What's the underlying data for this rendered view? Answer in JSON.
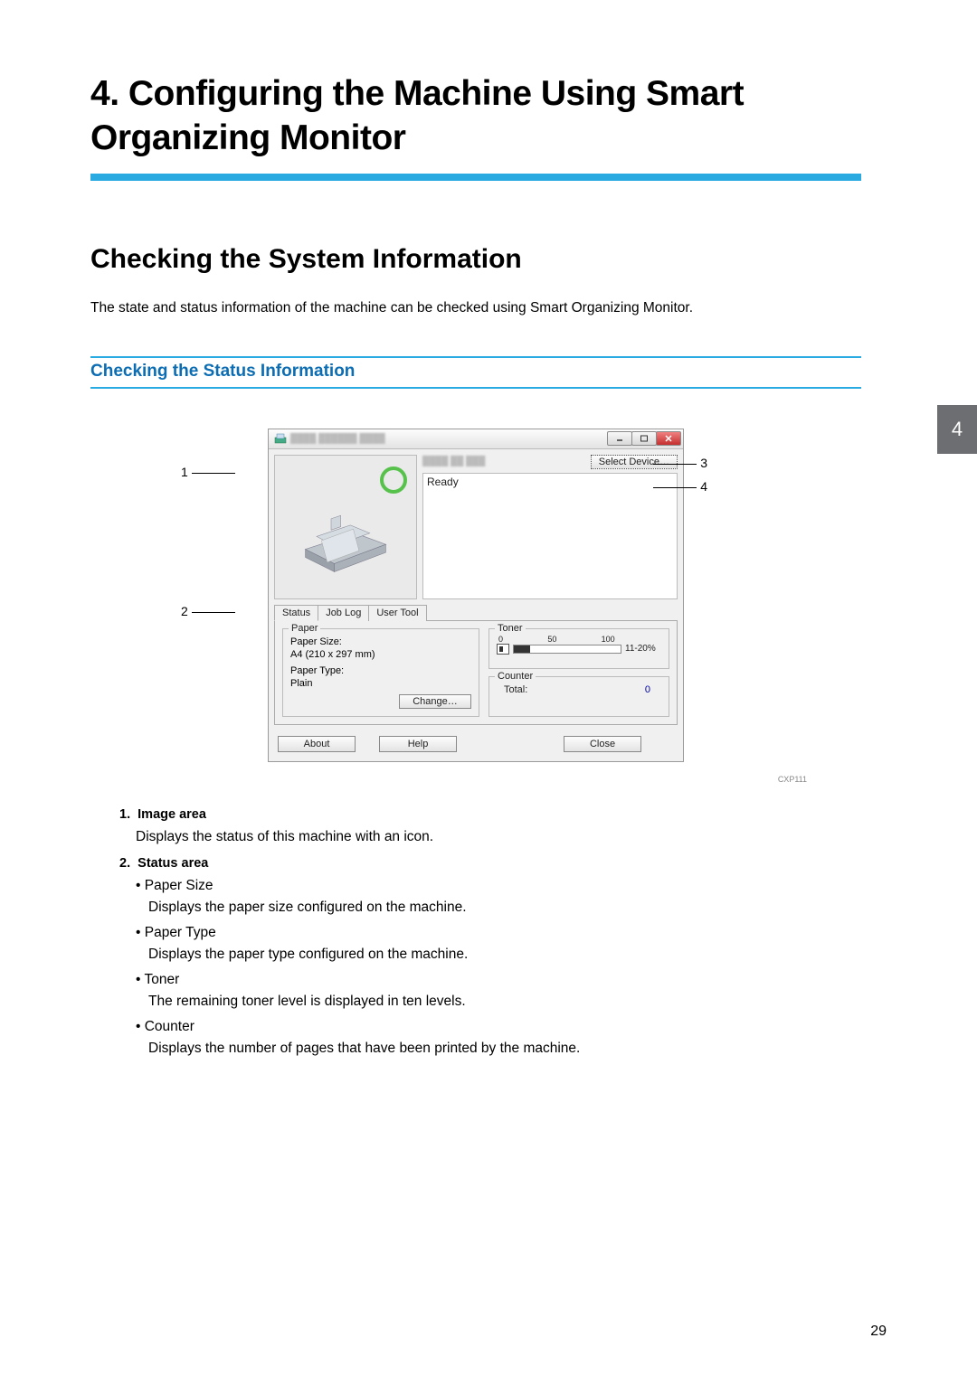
{
  "chapter": {
    "number": "4.",
    "title": "Configuring the Machine Using Smart Organizing Monitor"
  },
  "section": {
    "title": "Checking the System Information",
    "intro": "The state and status information of the machine can be checked using Smart Organizing Monitor."
  },
  "subsection": {
    "title": "Checking the Status Information"
  },
  "side_tab": "4",
  "figure": {
    "callouts": {
      "c1": "1",
      "c2": "2",
      "c3": "3",
      "c4": "4"
    },
    "caption": "CXP111",
    "window": {
      "select_device": "Select Device…",
      "status_msg": "Ready",
      "tabs": {
        "status": "Status",
        "joblog": "Job Log",
        "usertool": "User Tool"
      },
      "paper": {
        "legend": "Paper",
        "size_label": "Paper Size:",
        "size_value": "A4 (210 x 297 mm)",
        "type_label": "Paper Type:",
        "type_value": "Plain",
        "change": "Change…"
      },
      "toner": {
        "legend": "Toner",
        "scale0": "0",
        "scale50": "50",
        "scale100": "100",
        "pct": "11-20%"
      },
      "counter": {
        "legend": "Counter",
        "label": "Total:",
        "value": "0"
      },
      "buttons": {
        "about": "About",
        "help": "Help",
        "close": "Close"
      }
    }
  },
  "list": {
    "num1": "1.",
    "item1_title": "Image area",
    "item1_desc": "Displays the status of this machine with an icon.",
    "num2": "2.",
    "item2_title": "Status area",
    "bullets": {
      "b1_title": "Paper Size",
      "b1_desc": "Displays the paper size configured on the machine.",
      "b2_title": "Paper Type",
      "b2_desc": "Displays the paper type configured on the machine.",
      "b3_title": "Toner",
      "b3_desc": "The remaining toner level is displayed in ten levels.",
      "b4_title": "Counter",
      "b4_desc": "Displays the number of pages that have been printed by the machine."
    }
  },
  "page_number": "29"
}
